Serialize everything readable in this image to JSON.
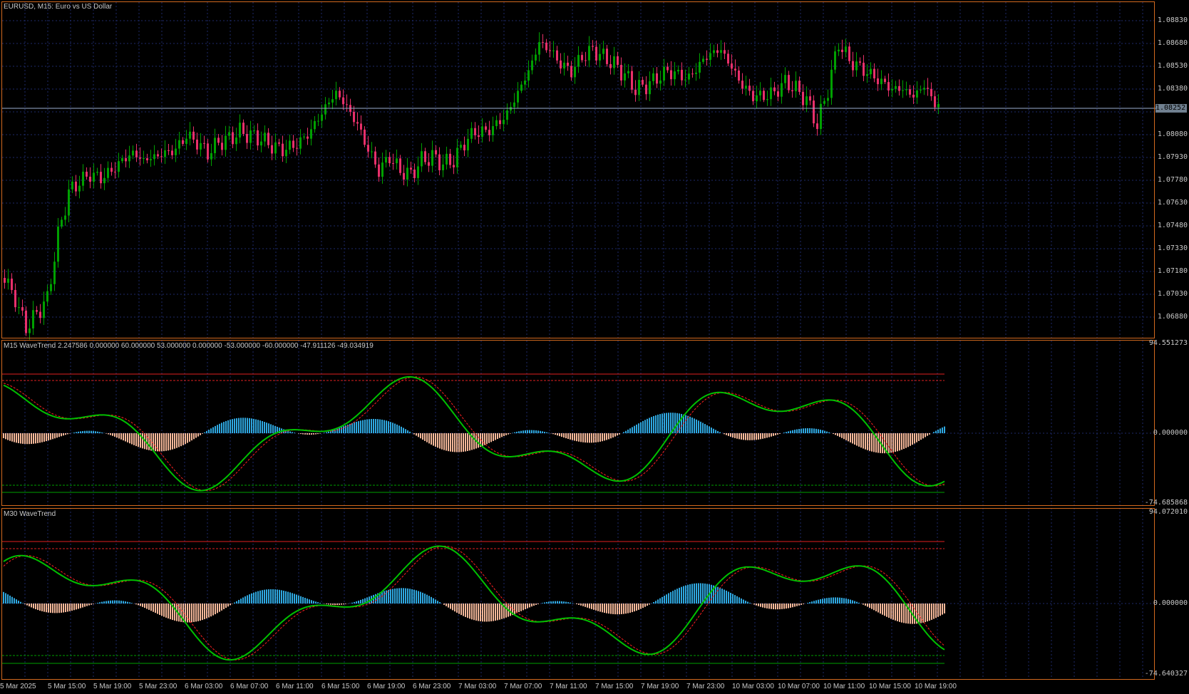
{
  "main_chart": {
    "title": "EURUSD, M15:  Euro vs US Dollar",
    "price_labels": [
      "1.08830",
      "1.08680",
      "1.08530",
      "1.08380",
      "1.08080",
      "1.07930",
      "1.07780",
      "1.07630",
      "1.07480",
      "1.07330",
      "1.07180",
      "1.07030",
      "1.06880"
    ],
    "current_price": "1.08252",
    "current_price_line_color": "#9aaecf"
  },
  "indicator_1": {
    "title": "M15 WaveTrend 2.247586 0.000000 60.000000 53.000000 0.000000 -53.000000 -60.000000 -47.911126 -49.034919",
    "max_label": "94.551273",
    "zero_label": "0.000000",
    "min_label": "-74.685868"
  },
  "indicator_2": {
    "title": "M30 WaveTrend",
    "max_label": "94.072010",
    "zero_label": "0.000000",
    "min_label": "-74.640327"
  },
  "time_axis": [
    "5 Mar 2025",
    "5 Mar 15:00",
    "5 Mar 19:00",
    "5 Mar 23:00",
    "6 Mar 03:00",
    "6 Mar 07:00",
    "6 Mar 11:00",
    "6 Mar 15:00",
    "6 Mar 19:00",
    "6 Mar 23:00",
    "7 Mar 03:00",
    "7 Mar 07:00",
    "7 Mar 11:00",
    "7 Mar 15:00",
    "7 Mar 19:00",
    "7 Mar 23:00",
    "10 Mar 03:00",
    "10 Mar 07:00",
    "10 Mar 11:00",
    "10 Mar 15:00",
    "10 Mar 19:00"
  ],
  "colors": {
    "bull_candle": "#00a000",
    "bear_candle": "#e8306a",
    "grid": "#1e2a6a",
    "frame": "#d2691e",
    "wt_line": "#00c000",
    "wt_signal": "#ff2020",
    "hist_pos": "#2fa8e0",
    "hist_neg": "#f4b89a"
  }
}
